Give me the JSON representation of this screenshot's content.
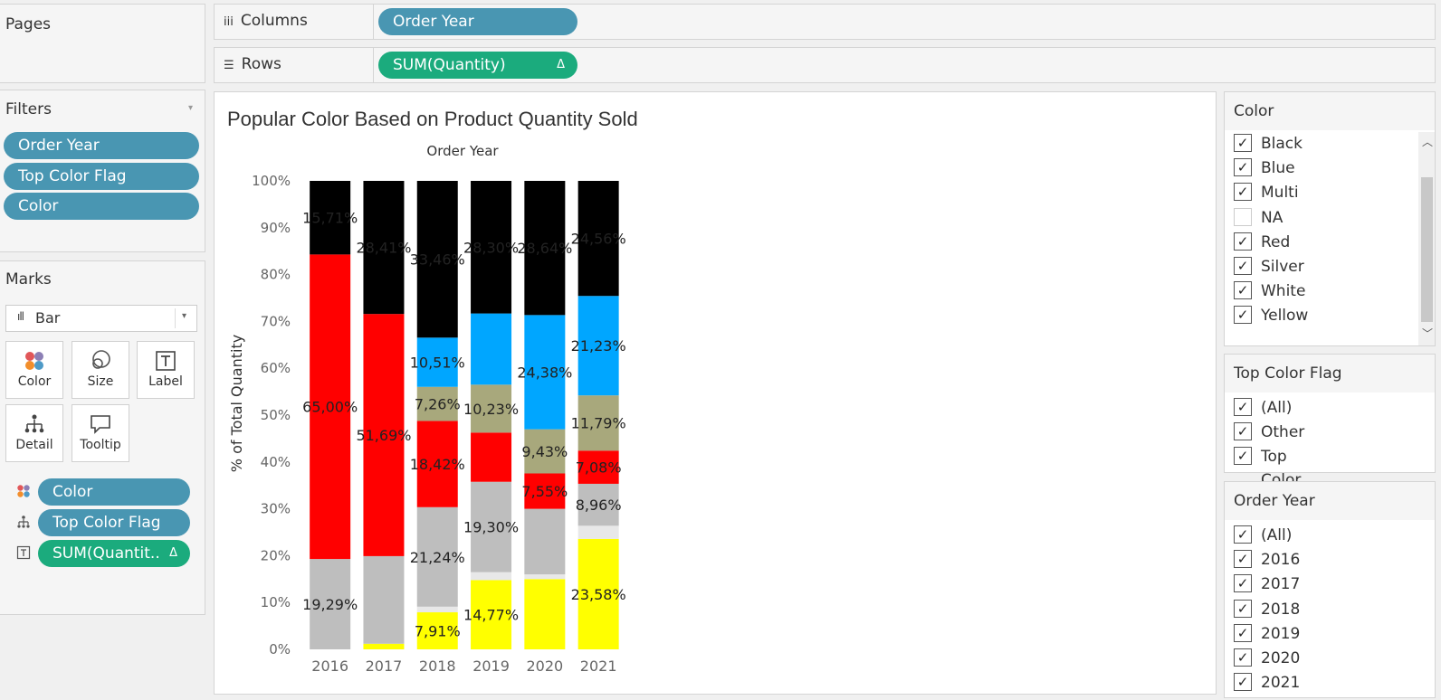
{
  "pages": {
    "title": "Pages"
  },
  "filters": {
    "title": "Filters",
    "pills": [
      "Order Year",
      "Top Color Flag",
      "Color"
    ]
  },
  "marks": {
    "title": "Marks",
    "mark_type": "Bar",
    "buttons": {
      "color": "Color",
      "size": "Size",
      "label": "Label",
      "detail": "Detail",
      "tooltip": "Tooltip"
    },
    "fields": [
      {
        "icon": "color-icon",
        "label": "Color",
        "style": "blue"
      },
      {
        "icon": "detail-icon",
        "label": "Top Color Flag",
        "style": "blue"
      },
      {
        "icon": "label-icon",
        "label": "SUM(Quantit..",
        "style": "green",
        "delta": "Δ"
      }
    ]
  },
  "shelves": {
    "columns_label": "Columns",
    "columns_pill": "Order Year",
    "rows_label": "Rows",
    "rows_pill": "SUM(Quantity)",
    "rows_delta": "Δ"
  },
  "chart_data": {
    "type": "bar",
    "stacked": true,
    "title": "Popular Color Based on Product Quantity Sold",
    "column_header": "Order Year",
    "ylabel": "% of Total Quantity",
    "ylim": [
      0,
      100
    ],
    "yticks": [
      "0%",
      "10%",
      "20%",
      "30%",
      "40%",
      "50%",
      "60%",
      "70%",
      "80%",
      "90%",
      "100%"
    ],
    "categories": [
      "2016",
      "2017",
      "2018",
      "2019",
      "2020",
      "2021"
    ],
    "series": [
      {
        "name": "Yellow",
        "color": "#ffff00",
        "values": [
          0,
          1.2,
          7.91,
          14.77,
          15.0,
          23.58
        ],
        "labels": [
          "",
          "",
          "7,91%",
          "14,77%",
          "",
          "23,58%"
        ]
      },
      {
        "name": "White",
        "color": "#e8e8e8",
        "values": [
          0,
          0,
          1.2,
          1.7,
          1.0,
          2.8
        ],
        "labels": [
          "",
          "",
          "",
          "",
          "",
          ""
        ]
      },
      {
        "name": "Silver",
        "color": "#bebebe",
        "values": [
          19.29,
          18.7,
          21.24,
          19.3,
          14.0,
          8.96
        ],
        "labels": [
          "19,29%",
          "",
          "21,24%",
          "19,30%",
          "",
          "8,96%"
        ]
      },
      {
        "name": "Red",
        "color": "#ff0000",
        "values": [
          65.0,
          51.69,
          18.42,
          10.5,
          7.55,
          7.08
        ],
        "labels": [
          "65,00%",
          "51,69%",
          "18,42%",
          "",
          "7,55%",
          "7,08%"
        ]
      },
      {
        "name": "Multi",
        "color": "#a8a87c",
        "values": [
          0,
          0,
          7.26,
          10.23,
          9.43,
          11.79
        ],
        "labels": [
          "",
          "",
          "7,26%",
          "10,23%",
          "9,43%",
          "11,79%"
        ]
      },
      {
        "name": "Blue",
        "color": "#00a6ff",
        "values": [
          0,
          0,
          10.51,
          15.2,
          24.38,
          21.23
        ],
        "labels": [
          "",
          "",
          "10,51%",
          "",
          "24,38%",
          "21,23%"
        ]
      },
      {
        "name": "Black",
        "color": "#000000",
        "values": [
          15.71,
          28.41,
          33.46,
          28.3,
          28.64,
          24.56
        ],
        "labels": [
          "15,71%",
          "28,41%",
          "33,46%",
          "28,30%",
          "28,64%",
          "24,56%"
        ]
      }
    ]
  },
  "legend_color": {
    "title": "Color",
    "items": [
      {
        "label": "Black",
        "checked": true
      },
      {
        "label": "Blue",
        "checked": true
      },
      {
        "label": "Multi",
        "checked": true
      },
      {
        "label": "NA",
        "checked": false
      },
      {
        "label": "Red",
        "checked": true
      },
      {
        "label": "Silver",
        "checked": true
      },
      {
        "label": "White",
        "checked": true
      },
      {
        "label": "Yellow",
        "checked": true
      }
    ]
  },
  "legend_flag": {
    "title": "Top Color Flag",
    "items": [
      {
        "label": "(All)",
        "checked": true
      },
      {
        "label": "Other",
        "checked": true
      },
      {
        "label": "Top Color",
        "checked": true
      }
    ]
  },
  "legend_year": {
    "title": "Order Year",
    "items": [
      {
        "label": "(All)",
        "checked": true
      },
      {
        "label": "2016",
        "checked": true
      },
      {
        "label": "2017",
        "checked": true
      },
      {
        "label": "2018",
        "checked": true
      },
      {
        "label": "2019",
        "checked": true
      },
      {
        "label": "2020",
        "checked": true
      },
      {
        "label": "2021",
        "checked": true
      }
    ]
  },
  "check_glyph": "✓"
}
